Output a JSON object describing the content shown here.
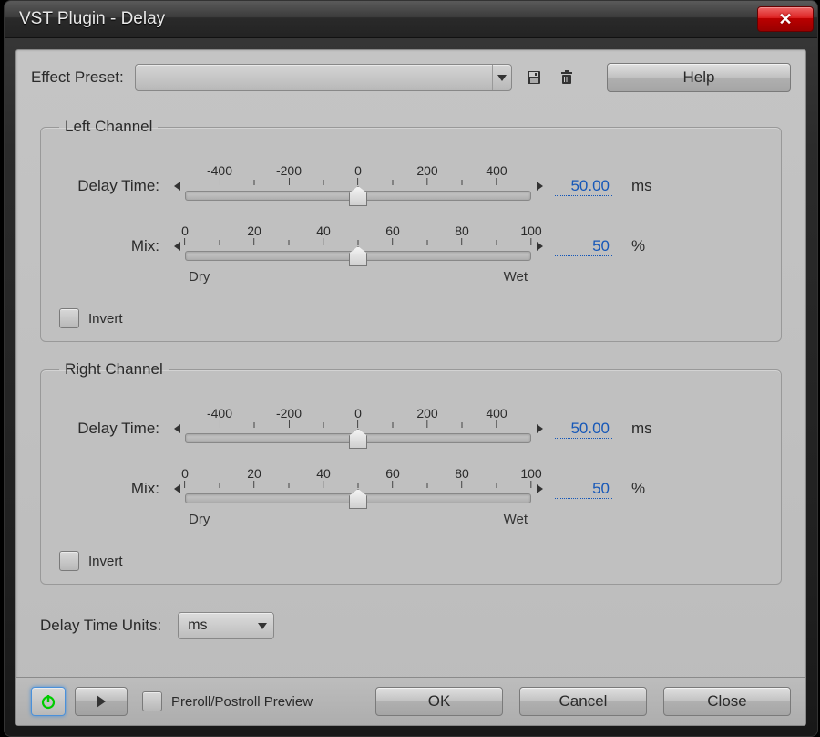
{
  "window": {
    "title": "VST Plugin - Delay"
  },
  "top": {
    "preset_label": "Effect Preset:",
    "help_label": "Help",
    "save_icon": "save-icon",
    "delete_icon": "trash-icon"
  },
  "left_channel": {
    "legend": "Left Channel",
    "delay": {
      "label": "Delay Time:",
      "ticks": [
        "-400",
        "-200",
        "0",
        "200",
        "400"
      ],
      "min": -500,
      "max": 500,
      "value": 0,
      "display": "50.00",
      "unit": "ms"
    },
    "mix": {
      "label": "Mix:",
      "ticks": [
        "0",
        "20",
        "40",
        "60",
        "80",
        "100"
      ],
      "min": 0,
      "max": 100,
      "value": 50,
      "display": "50",
      "unit": "%",
      "sub_left": "Dry",
      "sub_right": "Wet"
    },
    "invert_label": "Invert"
  },
  "right_channel": {
    "legend": "Right Channel",
    "delay": {
      "label": "Delay Time:",
      "ticks": [
        "-400",
        "-200",
        "0",
        "200",
        "400"
      ],
      "min": -500,
      "max": 500,
      "value": 0,
      "display": "50.00",
      "unit": "ms"
    },
    "mix": {
      "label": "Mix:",
      "ticks": [
        "0",
        "20",
        "40",
        "60",
        "80",
        "100"
      ],
      "min": 0,
      "max": 100,
      "value": 50,
      "display": "50",
      "unit": "%",
      "sub_left": "Dry",
      "sub_right": "Wet"
    },
    "invert_label": "Invert"
  },
  "units": {
    "label": "Delay Time Units:",
    "value": "ms"
  },
  "footer": {
    "preroll_label": "Preroll/Postroll Preview",
    "ok_label": "OK",
    "cancel_label": "Cancel",
    "close_label": "Close"
  }
}
